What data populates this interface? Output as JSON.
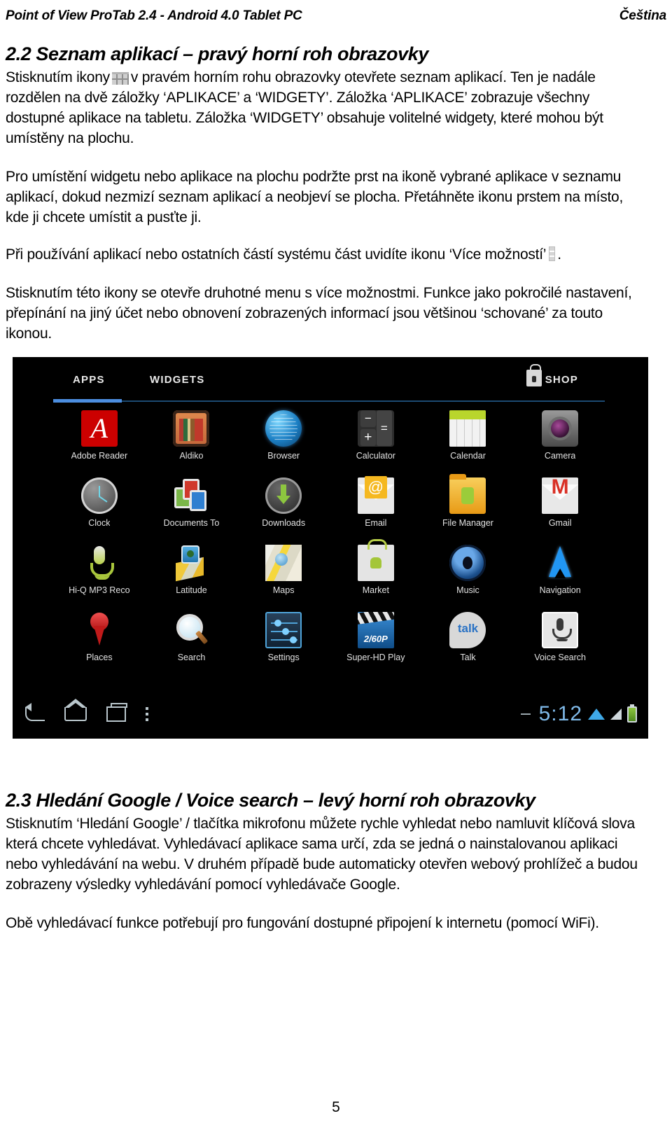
{
  "header": {
    "document_title": "Point of View ProTab 2.4 - Android 4.0 Tablet PC",
    "language": "Čeština"
  },
  "section_2_2": {
    "title": "2.2 Seznam aplikací – pravý horní roh obrazovky",
    "para1_before_icon": "Stisknutím ikony",
    "para1_after_icon": "v pravém horním rohu obrazovky otevřete seznam aplikací. Ten je nadále rozdělen na dvě záložky ‘APLIKACE’ a ‘WIDGETY’. Záložka ‘APLIKACE’ zobrazuje všechny dostupné aplikace na tabletu. Záložka ‘WIDGETY’ obsahuje volitelné widgety, které mohou být umístěny na plochu.",
    "para2": "Pro umístění widgetu nebo aplikace na plochu podržte prst na ikoně vybrané aplikace v seznamu aplikací, dokud nezmizí seznam aplikací a neobjeví se plocha. Přetáhněte ikonu prstem na místo, kde ji chcete umístit a pusťte ji.",
    "para3_before_icon": "Při používání aplikací nebo ostatních částí systému část uvidíte ikonu ‘Více možností’",
    "para3_after_icon": ".",
    "para4": "Stisknutím této ikony se otevře druhotné menu s více možnostmi. Funkce jako pokročilé nastavení, přepínání na jiný účet nebo obnovení zobrazených informací jsou většinou ‘schované’ za touto ikonou."
  },
  "tablet_screenshot": {
    "tabs": {
      "apps": "APPS",
      "widgets": "WIDGETS",
      "active": "APPS"
    },
    "shop": {
      "label": "SHOP",
      "icon": "shopping-bag-icon"
    },
    "accent_color": "#4c8ee0",
    "background_color": "#000000",
    "apps": [
      {
        "label": "Adobe Reader",
        "icon": "adobe-reader-icon"
      },
      {
        "label": "Aldiko",
        "icon": "aldiko-icon"
      },
      {
        "label": "Browser",
        "icon": "browser-icon"
      },
      {
        "label": "Calculator",
        "icon": "calculator-icon"
      },
      {
        "label": "Calendar",
        "icon": "calendar-icon"
      },
      {
        "label": "Camera",
        "icon": "camera-icon"
      },
      {
        "label": "Clock",
        "icon": "clock-icon"
      },
      {
        "label": "Documents To",
        "icon": "documents-to-go-icon"
      },
      {
        "label": "Downloads",
        "icon": "downloads-icon"
      },
      {
        "label": "Email",
        "icon": "email-icon"
      },
      {
        "label": "File Manager",
        "icon": "file-manager-icon"
      },
      {
        "label": "Gmail",
        "icon": "gmail-icon"
      },
      {
        "label": "Hi-Q MP3 Reco",
        "icon": "microphone-icon"
      },
      {
        "label": "Latitude",
        "icon": "latitude-icon"
      },
      {
        "label": "Maps",
        "icon": "maps-icon"
      },
      {
        "label": "Market",
        "icon": "market-icon"
      },
      {
        "label": "Music",
        "icon": "music-icon"
      },
      {
        "label": "Navigation",
        "icon": "navigation-arrow-icon"
      },
      {
        "label": "Places",
        "icon": "places-pin-icon"
      },
      {
        "label": "Search",
        "icon": "magnifier-icon"
      },
      {
        "label": "Settings",
        "icon": "settings-sliders-icon"
      },
      {
        "label": "Super-HD Play",
        "icon": "video-clapper-icon"
      },
      {
        "label": "Talk",
        "icon": "talk-bubble-icon"
      },
      {
        "label": "Voice Search",
        "icon": "voice-search-icon"
      }
    ],
    "system_bar": {
      "back": "back-icon",
      "home": "home-icon",
      "recents": "recents-icon",
      "menu": "more-options-icon",
      "clock": "5:12",
      "wifi": "wifi-icon",
      "signal": "signal-icon",
      "battery": "battery-icon"
    }
  },
  "section_2_3": {
    "title": "2.3 Hledání Google / Voice search – levý horní roh obrazovky",
    "para1": "Stisknutím ‘Hledání Google’ / tlačítka mikrofonu můžete rychle vyhledat nebo namluvit klíčová slova která chcete vyhledávat. Vyhledávací aplikace sama určí, zda se jedná o nainstalovanou aplikaci nebo vyhledávání na webu. V druhém případě bude automaticky otevřen webový prohlížeč a budou zobrazeny výsledky vyhledávání pomocí vyhledávače Google.",
    "para2": "Obě vyhledávací funkce potřebují pro fungování dostupné připojení k internetu (pomocí WiFi)."
  },
  "footer": {
    "page_number": "5"
  }
}
